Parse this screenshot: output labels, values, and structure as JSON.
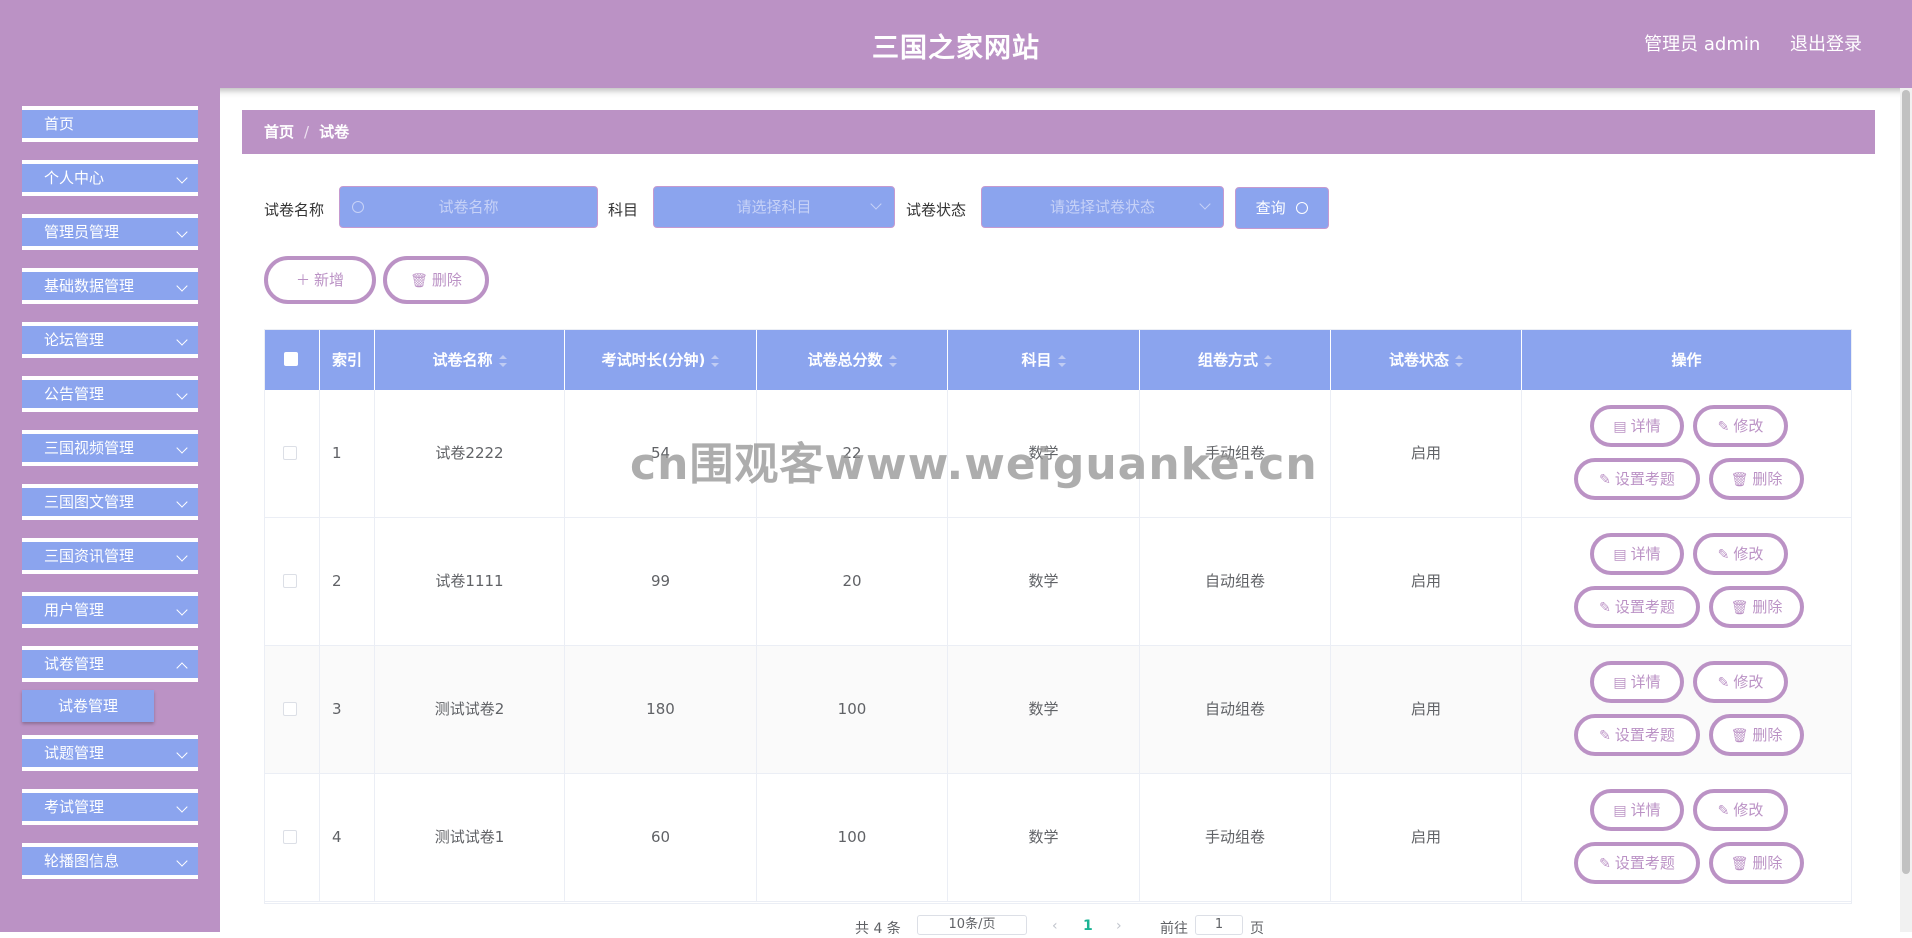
{
  "header": {
    "title": "三国之家网站",
    "user": "管理员 admin",
    "logout": "退出登录"
  },
  "sidebar": {
    "items": [
      {
        "label": "首页"
      },
      {
        "label": "个人中心"
      },
      {
        "label": "管理员管理"
      },
      {
        "label": "基础数据管理"
      },
      {
        "label": "论坛管理"
      },
      {
        "label": "公告管理"
      },
      {
        "label": "三国视频管理"
      },
      {
        "label": "三国图文管理"
      },
      {
        "label": "三国资讯管理"
      },
      {
        "label": "用户管理"
      },
      {
        "label": "试卷管理"
      },
      {
        "label": "试题管理"
      },
      {
        "label": "考试管理"
      },
      {
        "label": "轮播图信息"
      }
    ],
    "active_sub": "试卷管理"
  },
  "breadcrumb": {
    "home": "首页",
    "separator": "/",
    "current": "试卷"
  },
  "search": {
    "name_label": "试卷名称",
    "name_placeholder": "试卷名称",
    "subject_label": "科目",
    "subject_placeholder": "请选择科目",
    "status_label": "试卷状态",
    "status_placeholder": "请选择试卷状态",
    "query": "查询"
  },
  "actions": {
    "add": "新增",
    "delete": "删除"
  },
  "table": {
    "headers": [
      "索引",
      "试卷名称",
      "考试时长(分钟)",
      "试卷总分数",
      "科目",
      "组卷方式",
      "试卷状态",
      "操作"
    ],
    "rows": [
      {
        "index": "1",
        "name": "试卷2222",
        "duration": "54",
        "score": "22",
        "subject": "数学",
        "method": "手动组卷",
        "status": "启用"
      },
      {
        "index": "2",
        "name": "试卷1111",
        "duration": "99",
        "score": "20",
        "subject": "数学",
        "method": "自动组卷",
        "status": "启用"
      },
      {
        "index": "3",
        "name": "测试试卷2",
        "duration": "180",
        "score": "100",
        "subject": "数学",
        "method": "自动组卷",
        "status": "启用"
      },
      {
        "index": "4",
        "name": "测试试卷1",
        "duration": "60",
        "score": "100",
        "subject": "数学",
        "method": "手动组卷",
        "status": "启用"
      }
    ],
    "row_actions": {
      "detail": "详情",
      "edit": "修改",
      "setup": "设置考题",
      "delete": "删除"
    }
  },
  "watermark": "cn围观客www.weiguanke.cn",
  "pagination": {
    "total": "共 4 条",
    "page_size": "10条/页",
    "current_page": "1",
    "goto_prefix": "前往",
    "goto_value": "1",
    "goto_suffix": "页"
  },
  "colors": {
    "primary": "#bb92c5",
    "secondary": "#8ba4ee"
  }
}
